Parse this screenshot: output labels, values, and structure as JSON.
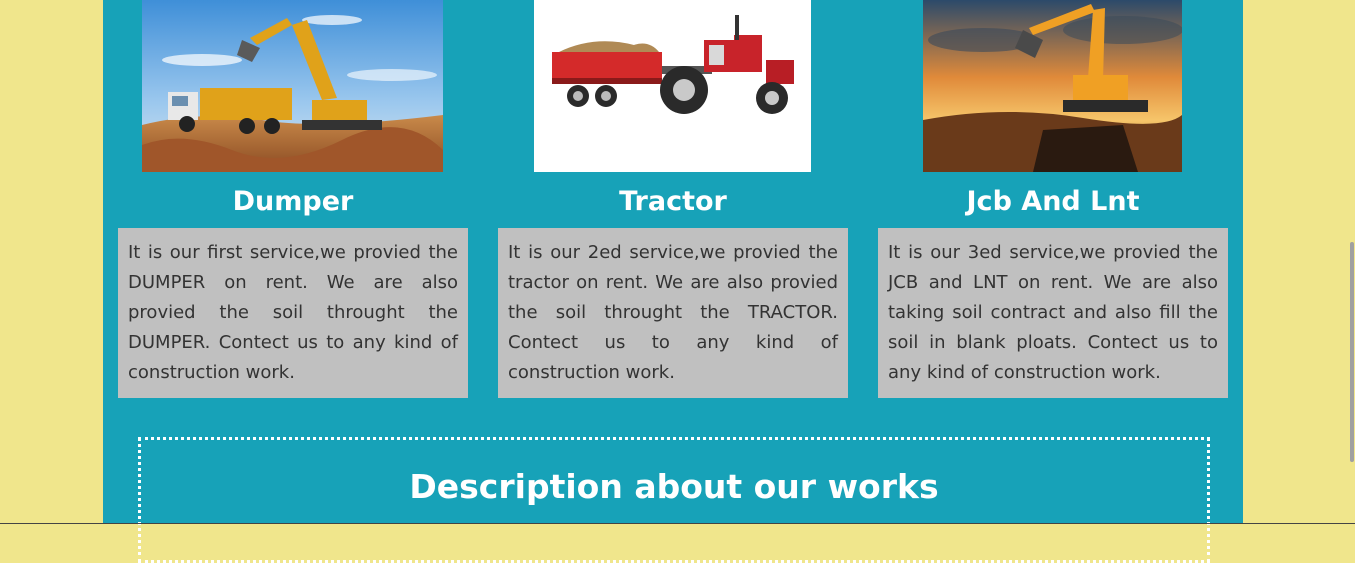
{
  "services": [
    {
      "title": "Dumper",
      "description": "It is our first service,we provied the DUMPER on rent. We are also provied the soil throught the DUMPER. Contect us to any kind of construction work.",
      "image_icon": "dumper-truck-excavator-photo"
    },
    {
      "title": "Tractor",
      "description": "It is our 2ed service,we provied the tractor on rent. We are also provied the soil throught the TRACTOR. Contect us to any kind of construction work.",
      "image_icon": "red-tractor-trolley-photo"
    },
    {
      "title": "Jcb And Lnt",
      "description": "It is our 3ed service,we provied the JCB and LNT on rent. We are also taking soil contract and also fill the soil in blank ploats. Contect us to any kind of construction work.",
      "image_icon": "excavator-sunset-photo"
    }
  ],
  "works": {
    "heading": "Description about our works"
  },
  "colors": {
    "background": "#f0e68c",
    "container": "#17a2b8",
    "card": "#c0c0c0",
    "heading_text": "#ffffff"
  }
}
